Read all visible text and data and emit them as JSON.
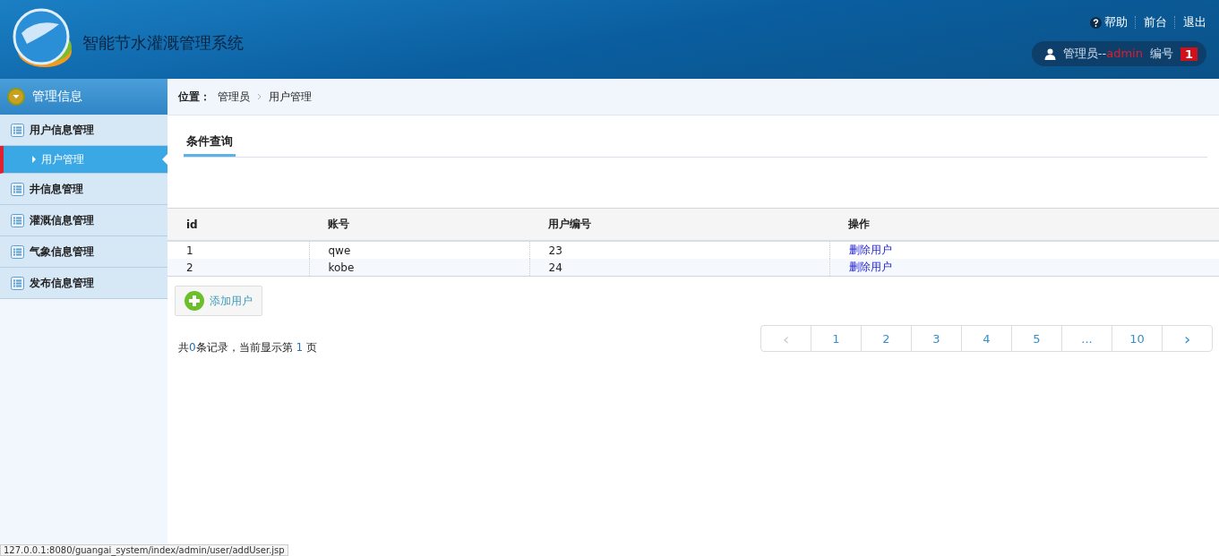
{
  "header": {
    "title": "智能节水灌溉管理系统",
    "links": [
      {
        "label": "帮助",
        "kind": "help"
      },
      {
        "label": "前台",
        "kind": "plain"
      },
      {
        "label": "退出",
        "kind": "plain"
      }
    ],
    "user": {
      "role": "管理员--",
      "name": "admin",
      "number_label": "编号",
      "number": "1"
    }
  },
  "sidebar": {
    "heading": "管理信息",
    "items": [
      {
        "label": "用户信息管理",
        "children": [
          {
            "label": "用户管理",
            "selected": true
          }
        ]
      },
      {
        "label": "井信息管理"
      },
      {
        "label": "灌溉信息管理"
      },
      {
        "label": "气象信息管理"
      },
      {
        "label": "发布信息管理"
      }
    ]
  },
  "breadcrumb": {
    "label": "位置：",
    "path": [
      "管理员",
      "用户管理"
    ]
  },
  "query_tab": "条件查询",
  "table": {
    "columns": [
      "id",
      "账号",
      "用户编号",
      "操作"
    ],
    "rows": [
      {
        "id": "1",
        "account": "qwe",
        "number": "23",
        "action": "删除用户"
      },
      {
        "id": "2",
        "account": "kobe",
        "number": "24",
        "action": "删除用户"
      }
    ]
  },
  "add_button": "添加用户",
  "summary": {
    "before": "共",
    "count": "0",
    "middle": "条记录，当前显示第",
    "page": "1",
    "after": "页"
  },
  "pagination": {
    "prev": {
      "label": "‹",
      "disabled": true
    },
    "pages": [
      "1",
      "2",
      "3",
      "4",
      "5",
      "...",
      "10"
    ],
    "next": {
      "label": "›",
      "disabled": false
    }
  },
  "status_url": "127.0.0.1:8080/guangai_system/index/admin/user/addUser.jsp"
}
